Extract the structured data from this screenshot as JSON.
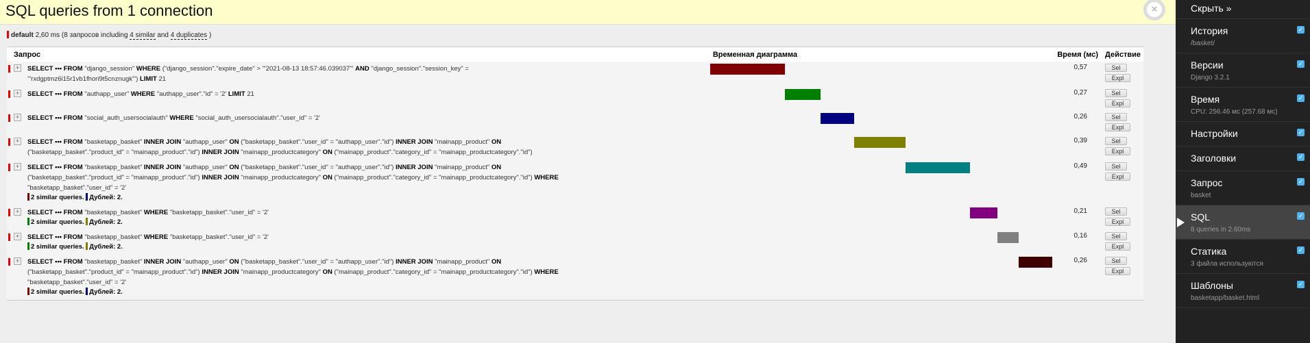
{
  "header": {
    "title": "SQL queries from 1 connection",
    "close_label": "×"
  },
  "summary": {
    "alias": "default",
    "time": "2,60 ms",
    "pre": "(8 запросов including",
    "similar": "4 similar",
    "and": "and",
    "duplicates": "4 duplicates",
    ")": ")"
  },
  "table": {
    "headers": [
      "Запрос",
      "Временная диаграмма",
      "Время (мс)",
      "Действие"
    ],
    "total_ms": 2.6,
    "rows": [
      {
        "time": "0,57",
        "ms": 0.57,
        "color": "#800000",
        "sql": [
          [
            "k",
            "SELECT ••• FROM"
          ],
          [
            "t",
            " \"django_session\" "
          ],
          [
            "k",
            "WHERE"
          ],
          [
            "t",
            " (\"django_session\".\"expire_date\" > '\"2021-08-13 18:57:46.039037\"' "
          ],
          [
            "k",
            "AND"
          ],
          [
            "t",
            " \"django_session\".\"session_key\" = '\"rxdgptmz6i15r1vb1fhori9t5cnznugk\"') "
          ],
          [
            "k",
            "LIMIT"
          ],
          [
            "t",
            " 21"
          ]
        ]
      },
      {
        "time": "0,27",
        "ms": 0.27,
        "color": "#008000",
        "sql": [
          [
            "k",
            "SELECT ••• FROM"
          ],
          [
            "t",
            " \"authapp_user\" "
          ],
          [
            "k",
            "WHERE"
          ],
          [
            "t",
            " \"authapp_user\".\"id\" = '2' "
          ],
          [
            "k",
            "LIMIT"
          ],
          [
            "t",
            " 21"
          ]
        ]
      },
      {
        "time": "0,26",
        "ms": 0.26,
        "color": "#000080",
        "sql": [
          [
            "k",
            "SELECT ••• FROM"
          ],
          [
            "t",
            " \"social_auth_usersocialauth\" "
          ],
          [
            "k",
            "WHERE"
          ],
          [
            "t",
            " \"social_auth_usersocialauth\".\"user_id\" = '2'"
          ]
        ]
      },
      {
        "time": "0,39",
        "ms": 0.39,
        "color": "#808000",
        "sql": [
          [
            "k",
            "SELECT ••• FROM"
          ],
          [
            "t",
            " \"basketapp_basket\" "
          ],
          [
            "k",
            "INNER JOIN"
          ],
          [
            "t",
            " \"authapp_user\" "
          ],
          [
            "k",
            "ON"
          ],
          [
            "t",
            " (\"basketapp_basket\".\"user_id\" = \"authapp_user\".\"id\") "
          ],
          [
            "k",
            "INNER JOIN"
          ],
          [
            "t",
            " \"mainapp_product\" "
          ],
          [
            "k",
            "ON"
          ],
          [
            "t",
            " (\"basketapp_basket\".\"product_id\" = \"mainapp_product\".\"id\") "
          ],
          [
            "k",
            "INNER JOIN"
          ],
          [
            "t",
            " \"mainapp_productcategory\" "
          ],
          [
            "k",
            "ON"
          ],
          [
            "t",
            " (\"mainapp_product\".\"category_id\" = \"mainapp_productcategory\".\"id\")"
          ]
        ]
      },
      {
        "time": "0,49",
        "ms": 0.49,
        "color": "#008080",
        "sql": [
          [
            "k",
            "SELECT ••• FROM"
          ],
          [
            "t",
            " \"basketapp_basket\" "
          ],
          [
            "k",
            "INNER JOIN"
          ],
          [
            "t",
            " \"authapp_user\" "
          ],
          [
            "k",
            "ON"
          ],
          [
            "t",
            " (\"basketapp_basket\".\"user_id\" = \"authapp_user\".\"id\") "
          ],
          [
            "k",
            "INNER JOIN"
          ],
          [
            "t",
            " \"mainapp_product\" "
          ],
          [
            "k",
            "ON"
          ],
          [
            "t",
            " (\"basketapp_basket\".\"product_id\" = \"mainapp_product\".\"id\") "
          ],
          [
            "k",
            "INNER JOIN"
          ],
          [
            "t",
            " \"mainapp_productcategory\" "
          ],
          [
            "k",
            "ON"
          ],
          [
            "t",
            " (\"mainapp_product\".\"category_id\" = \"mainapp_productcategory\".\"id\") "
          ],
          [
            "k",
            "WHERE"
          ],
          [
            "t",
            " \"basketapp_basket\".\"user_id\" = '2'"
          ]
        ],
        "similar": {
          "text": "2 similar queries.",
          "color": "#800000"
        },
        "dup": {
          "text": "Дублей: 2.",
          "color": "#000080"
        }
      },
      {
        "time": "0,21",
        "ms": 0.21,
        "color": "#800080",
        "sql": [
          [
            "k",
            "SELECT ••• FROM"
          ],
          [
            "t",
            " \"basketapp_basket\" "
          ],
          [
            "k",
            "WHERE"
          ],
          [
            "t",
            " \"basketapp_basket\".\"user_id\" = '2'"
          ]
        ],
        "similar": {
          "text": "2 similar queries.",
          "color": "#008000"
        },
        "dup": {
          "text": "Дублей: 2.",
          "color": "#808000"
        }
      },
      {
        "time": "0,16",
        "ms": 0.16,
        "color": "#808080",
        "sql": [
          [
            "k",
            "SELECT ••• FROM"
          ],
          [
            "t",
            " \"basketapp_basket\" "
          ],
          [
            "k",
            "WHERE"
          ],
          [
            "t",
            " \"basketapp_basket\".\"user_id\" = '2'"
          ]
        ],
        "similar": {
          "text": "2 similar queries.",
          "color": "#008000"
        },
        "dup": {
          "text": "Дублей: 2.",
          "color": "#808000"
        }
      },
      {
        "time": "0,26",
        "ms": 0.26,
        "color": "#400000",
        "sql": [
          [
            "k",
            "SELECT ••• FROM"
          ],
          [
            "t",
            " \"basketapp_basket\" "
          ],
          [
            "k",
            "INNER JOIN"
          ],
          [
            "t",
            " \"authapp_user\" "
          ],
          [
            "k",
            "ON"
          ],
          [
            "t",
            " (\"basketapp_basket\".\"user_id\" = \"authapp_user\".\"id\") "
          ],
          [
            "k",
            "INNER JOIN"
          ],
          [
            "t",
            " \"mainapp_product\" "
          ],
          [
            "k",
            "ON"
          ],
          [
            "t",
            " (\"basketapp_basket\".\"product_id\" = \"mainapp_product\".\"id\") "
          ],
          [
            "k",
            "INNER JOIN"
          ],
          [
            "t",
            " \"mainapp_productcategory\" "
          ],
          [
            "k",
            "ON"
          ],
          [
            "t",
            " (\"mainapp_product\".\"category_id\" = \"mainapp_productcategory\".\"id\") "
          ],
          [
            "k",
            "WHERE"
          ],
          [
            "t",
            " \"basketapp_basket\".\"user_id\" = '2'"
          ]
        ],
        "similar": {
          "text": "2 similar queries.",
          "color": "#800000"
        },
        "dup": {
          "text": "Дублей: 2.",
          "color": "#000080"
        }
      }
    ],
    "sel_label": "Sel",
    "expl_label": "Expl",
    "toggle_label": "+"
  },
  "sidebar": {
    "hide_label": "Скрыть »",
    "items": [
      {
        "label": "История",
        "sub": "/basket/"
      },
      {
        "label": "Версии",
        "sub": "Django 3.2.1"
      },
      {
        "label": "Время",
        "sub": "CPU: 256.46 мс (257.68 мс)"
      },
      {
        "label": "Настройки",
        "sub": null
      },
      {
        "label": "Заголовки",
        "sub": null
      },
      {
        "label": "Запрос",
        "sub": "basket"
      },
      {
        "label": "SQL",
        "sub": "8 queries in 2.60ms",
        "active": true
      },
      {
        "label": "Статика",
        "sub": "3 файла используются"
      },
      {
        "label": "Шаблоны",
        "sub": "basketapp/basket.html"
      }
    ]
  }
}
